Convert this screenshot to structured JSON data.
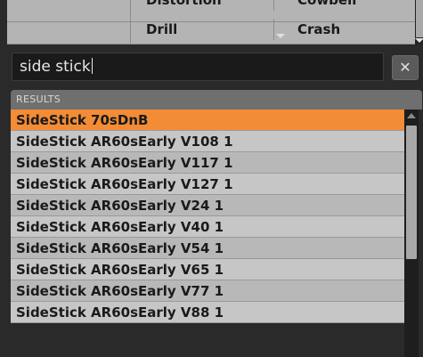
{
  "tags": {
    "left_column": [
      "Distortion",
      "Drill"
    ],
    "right_column": [
      "Cowbell",
      "Crash"
    ]
  },
  "search": {
    "value": "side stick",
    "clear_icon": "✕"
  },
  "results": {
    "header": "RESULTS",
    "items": [
      "SideStick 70sDnB",
      "SideStick AR60sEarly V108 1",
      "SideStick AR60sEarly V117 1",
      "SideStick AR60sEarly V127 1",
      "SideStick AR60sEarly V24 1",
      "SideStick AR60sEarly V40 1",
      "SideStick AR60sEarly V54 1",
      "SideStick AR60sEarly V65 1",
      "SideStick AR60sEarly V77 1",
      "SideStick AR60sEarly V88 1"
    ],
    "selected_index": 0
  },
  "colors": {
    "selection": "#f28c36",
    "row_light": "#c6c6c6",
    "background": "#2a2a2a"
  }
}
